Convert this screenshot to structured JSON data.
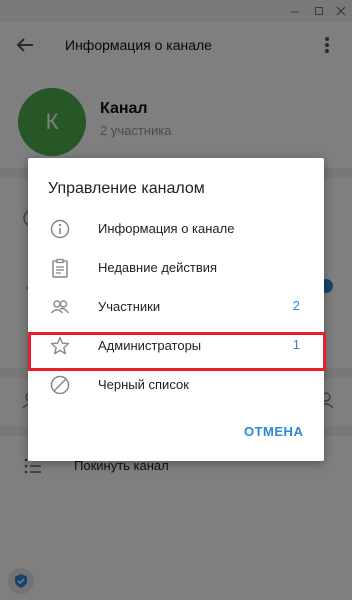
{
  "titlebar": {
    "minimize_icon": "minimize-icon",
    "maximize_icon": "maximize-icon",
    "close_icon": "close-icon"
  },
  "header": {
    "title": "Информация о канале",
    "back_icon": "arrow-left-icon",
    "menu_icon": "kebab-icon"
  },
  "channel": {
    "avatar_letter": "К",
    "avatar_color": "#4fae4e",
    "name": "Канал",
    "subtitle": "2 участника"
  },
  "leave": {
    "label": "Покинуть канал",
    "icon": "list-icon"
  },
  "dialog": {
    "title": "Управление каналом",
    "items": [
      {
        "label": "Информация о канале",
        "icon": "info-icon",
        "count": ""
      },
      {
        "label": "Недавние действия",
        "icon": "clipboard-icon",
        "count": ""
      },
      {
        "label": "Участники",
        "icon": "users-icon",
        "count": "2"
      },
      {
        "label": "Администраторы",
        "icon": "star-icon",
        "count": "1"
      },
      {
        "label": "Черный список",
        "icon": "block-icon",
        "count": ""
      }
    ],
    "cancel_label": "ОТМЕНА"
  },
  "colors": {
    "accent": "#2b88d8",
    "highlight": "#e3202b"
  }
}
